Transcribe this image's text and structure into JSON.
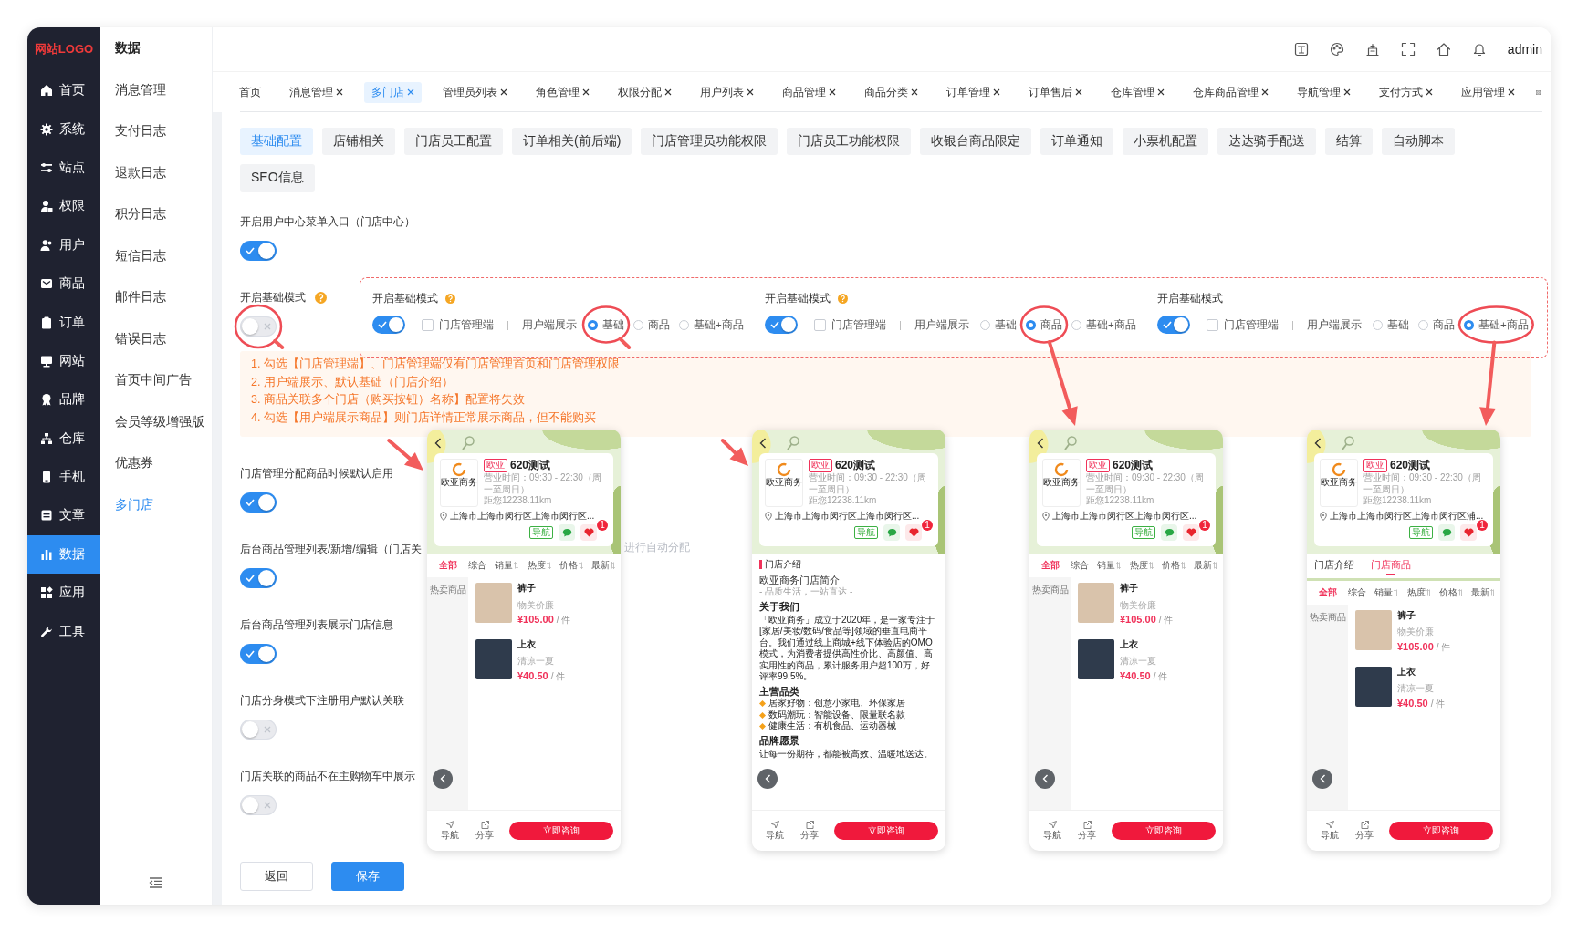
{
  "sidebar": {
    "logo": "网站LOGO",
    "items": [
      {
        "label": "首页",
        "selected": false
      },
      {
        "label": "系统",
        "selected": false
      },
      {
        "label": "站点",
        "selected": false
      },
      {
        "label": "权限",
        "selected": false
      },
      {
        "label": "用户",
        "selected": false
      },
      {
        "label": "商品",
        "selected": false
      },
      {
        "label": "订单",
        "selected": false
      },
      {
        "label": "网站",
        "selected": false
      },
      {
        "label": "品牌",
        "selected": false
      },
      {
        "label": "仓库",
        "selected": false
      },
      {
        "label": "手机",
        "selected": false
      },
      {
        "label": "文章",
        "selected": false
      },
      {
        "label": "数据",
        "selected": true
      },
      {
        "label": "应用",
        "selected": false
      },
      {
        "label": "工具",
        "selected": false
      }
    ]
  },
  "submenu": {
    "title": "数据",
    "items": [
      {
        "label": "消息管理",
        "selected": false
      },
      {
        "label": "支付日志",
        "selected": false
      },
      {
        "label": "退款日志",
        "selected": false
      },
      {
        "label": "积分日志",
        "selected": false
      },
      {
        "label": "短信日志",
        "selected": false
      },
      {
        "label": "邮件日志",
        "selected": false
      },
      {
        "label": "错误日志",
        "selected": false
      },
      {
        "label": "首页中间广告",
        "selected": false
      },
      {
        "label": "会员等级增强版",
        "selected": false
      },
      {
        "label": "优惠券",
        "selected": false
      },
      {
        "label": "多门店",
        "selected": true
      }
    ]
  },
  "header": {
    "user": "admin"
  },
  "tabs": [
    {
      "label": "首页",
      "selected": false,
      "closable": false
    },
    {
      "label": "消息管理",
      "selected": false,
      "closable": true
    },
    {
      "label": "多门店",
      "selected": true,
      "closable": true
    },
    {
      "label": "管理员列表",
      "selected": false,
      "closable": true
    },
    {
      "label": "角色管理",
      "selected": false,
      "closable": true
    },
    {
      "label": "权限分配",
      "selected": false,
      "closable": true
    },
    {
      "label": "用户列表",
      "selected": false,
      "closable": true
    },
    {
      "label": "商品管理",
      "selected": false,
      "closable": true
    },
    {
      "label": "商品分类",
      "selected": false,
      "closable": true
    },
    {
      "label": "订单管理",
      "selected": false,
      "closable": true
    },
    {
      "label": "订单售后",
      "selected": false,
      "closable": true
    },
    {
      "label": "仓库管理",
      "selected": false,
      "closable": true
    },
    {
      "label": "仓库商品管理",
      "selected": false,
      "closable": true
    },
    {
      "label": "导航管理",
      "selected": false,
      "closable": true
    },
    {
      "label": "支付方式",
      "selected": false,
      "closable": true
    },
    {
      "label": "应用管理",
      "selected": false,
      "closable": true
    }
  ],
  "config_tabs": [
    {
      "label": "基础配置",
      "selected": true
    },
    {
      "label": "店铺相关",
      "selected": false
    },
    {
      "label": "门店员工配置",
      "selected": false
    },
    {
      "label": "订单相关(前后端)",
      "selected": false
    },
    {
      "label": "门店管理员功能权限",
      "selected": false
    },
    {
      "label": "门店员工功能权限",
      "selected": false
    },
    {
      "label": "收银台商品限定",
      "selected": false
    },
    {
      "label": "订单通知",
      "selected": false
    },
    {
      "label": "小票机配置",
      "selected": false
    },
    {
      "label": "达达骑手配送",
      "selected": false
    },
    {
      "label": "结算",
      "selected": false
    },
    {
      "label": "自动脚本",
      "selected": false
    },
    {
      "label": "SEO信息",
      "selected": false
    }
  ],
  "settings": [
    {
      "label": "开启用户中心菜单入口（门店中心）",
      "help": false,
      "on": true
    },
    {
      "label": "开启基础模式",
      "help": true,
      "on": false,
      "notes": [
        "1. 勾选【门店管理端】、门店管理端仅有门店管理首页和门店管理权限",
        "2. 用户端展示、默认基础（门店介绍）",
        "3. 商品关联多个门店（购买按钮）名称】配置将失效",
        "4. 勾选【用户端展示商品】则门店详情正常展示商品，但不能购买"
      ]
    },
    {
      "label": "门店管理分配商品时候默认启用",
      "help": false,
      "on": true
    },
    {
      "label": "后台商品管理列表/新增/编辑（门店关",
      "label_tail": "进行自动分配",
      "help": false,
      "on": true
    },
    {
      "label": "后台商品管理列表展示门店信息",
      "help": false,
      "on": true
    },
    {
      "label": "门店分身模式下注册用户默认关联",
      "help": false,
      "on": false
    },
    {
      "label": "门店关联的商品不在主购物车中展示",
      "help": false,
      "on": false
    }
  ],
  "mode_examples": [
    {
      "title": "开启基础模式",
      "help": true,
      "on": true,
      "checkbox": {
        "label": "门店管理端",
        "checked": false
      },
      "separator": "|",
      "display_label": "用户端展示",
      "options": [
        {
          "label": "基础",
          "selected": true
        },
        {
          "label": "商品",
          "selected": false
        },
        {
          "label": "基础+商品",
          "selected": false
        }
      ]
    },
    {
      "title": "开启基础模式",
      "help": true,
      "on": true,
      "checkbox": {
        "label": "门店管理端",
        "checked": false
      },
      "separator": "|",
      "display_label": "用户端展示",
      "options": [
        {
          "label": "基础",
          "selected": false
        },
        {
          "label": "商品",
          "selected": true
        },
        {
          "label": "基础+商品",
          "selected": false
        }
      ]
    },
    {
      "title": "开启基础模式",
      "help": false,
      "on": true,
      "checkbox": {
        "label": "门店管理端",
        "checked": false
      },
      "separator": "|",
      "display_label": "用户端展示",
      "options": [
        {
          "label": "基础",
          "selected": false
        },
        {
          "label": "商品",
          "selected": false
        },
        {
          "label": "基础+商品",
          "selected": true
        }
      ]
    }
  ],
  "phone_previews": [
    {
      "kind": "products",
      "store": {
        "logo_text": "欧亚商务",
        "tag": "欧亚",
        "name": "620测试",
        "hours": "营业时间：09:30 - 22:30（周一至周日）",
        "distance": "距您12238.11km",
        "address": "上海市上海市闵行区上海市闵行区...",
        "nav": "导航",
        "badge": "1"
      },
      "sort_tabs": [
        {
          "label": "全部",
          "selected": true,
          "sortable": false
        },
        {
          "label": "综合",
          "selected": false,
          "sortable": false
        },
        {
          "label": "销量",
          "selected": false,
          "sortable": true
        },
        {
          "label": "热度",
          "selected": false,
          "sortable": true
        },
        {
          "label": "价格",
          "selected": false,
          "sortable": true
        },
        {
          "label": "最新",
          "selected": false,
          "sortable": true
        }
      ],
      "category": "热卖商品",
      "products": [
        {
          "name": "裤子",
          "desc": "物美价廉",
          "price": "¥105.00",
          "unit": "/ 件"
        },
        {
          "name": "上衣",
          "desc": "清凉一夏",
          "price": "¥40.50",
          "unit": "/ 件"
        }
      ],
      "footer": {
        "nav": "导航",
        "share": "分享",
        "cta": "立即咨询"
      }
    },
    {
      "kind": "intro",
      "store": {
        "logo_text": "欧亚商务",
        "tag": "欧亚",
        "name": "620测试",
        "hours": "营业时间：09:30 - 22:30（周一至周日）",
        "distance": "距您12238.11km",
        "address": "上海市上海市闵行区上海市闵行区...",
        "nav": "导航",
        "badge": "1"
      },
      "intro": {
        "title": "门店介绍",
        "heading": "欧亚商务门店简介",
        "subtitle": "- 品质生活，一站直达 -",
        "blocks": [
          {
            "kind": "heading",
            "text": "关于我们"
          },
          {
            "kind": "paragraph",
            "text": "「欧亚商务」成立于2020年，是一家专注于[家居/美妆/数码/食品等]领域的垂直电商平台。我们通过线上商城+线下体验店的OMO模式，为消费者提供高性价比、高颜值、高实用性的商品，累计服务用户超100万，好评率99.5%。"
          },
          {
            "kind": "heading",
            "text": "主营品类"
          },
          {
            "kind": "bullet",
            "text": "居家好物：创意小家电、环保家居"
          },
          {
            "kind": "bullet",
            "text": "数码潮玩：智能设备、限量联名款"
          },
          {
            "kind": "bullet",
            "text": "健康生活：有机食品、运动器械"
          },
          {
            "kind": "heading",
            "text": "品牌愿景"
          },
          {
            "kind": "paragraph",
            "text": "让每一份期待，都能被高效、温暖地送达。"
          }
        ]
      },
      "footer": {
        "nav": "导航",
        "share": "分享",
        "cta": "立即咨询"
      }
    },
    {
      "kind": "products",
      "store": {
        "logo_text": "欧亚商务",
        "tag": "欧亚",
        "name": "620测试",
        "hours": "营业时间：09:30 - 22:30（周一至周日）",
        "distance": "距您12238.11km",
        "address": "上海市上海市闵行区上海市闵行区...",
        "nav": "导航",
        "badge": "1"
      },
      "sort_tabs": [
        {
          "label": "全部",
          "selected": true,
          "sortable": false
        },
        {
          "label": "综合",
          "selected": false,
          "sortable": false
        },
        {
          "label": "销量",
          "selected": false,
          "sortable": true
        },
        {
          "label": "热度",
          "selected": false,
          "sortable": true
        },
        {
          "label": "价格",
          "selected": false,
          "sortable": true
        },
        {
          "label": "最新",
          "selected": false,
          "sortable": true
        }
      ],
      "category": "热卖商品",
      "products": [
        {
          "name": "裤子",
          "desc": "物美价廉",
          "price": "¥105.00",
          "unit": "/ 件"
        },
        {
          "name": "上衣",
          "desc": "清凉一夏",
          "price": "¥40.50",
          "unit": "/ 件"
        }
      ],
      "footer": {
        "nav": "导航",
        "share": "分享",
        "cta": "立即咨询"
      }
    },
    {
      "kind": "products",
      "store": {
        "logo_text": "欧亚商务",
        "tag": "欧亚",
        "name": "620测试",
        "hours": "营业时间：09:30 - 22:30（周一至周日）",
        "distance": "距您12238.11km",
        "address": "上海市上海市闵行区上海市闵行区浦...",
        "nav": "导航",
        "badge": "1"
      },
      "store_tabs": [
        {
          "label": "门店介绍",
          "selected": false
        },
        {
          "label": "门店商品",
          "selected": true
        }
      ],
      "sort_tabs": [
        {
          "label": "全部",
          "selected": true,
          "sortable": false
        },
        {
          "label": "综合",
          "selected": false,
          "sortable": false
        },
        {
          "label": "销量",
          "selected": false,
          "sortable": true
        },
        {
          "label": "热度",
          "selected": false,
          "sortable": true
        },
        {
          "label": "价格",
          "selected": false,
          "sortable": true
        },
        {
          "label": "最新",
          "selected": false,
          "sortable": true
        }
      ],
      "category": "热卖商品",
      "products": [
        {
          "name": "裤子",
          "desc": "物美价廉",
          "price": "¥105.00",
          "unit": "/ 件"
        },
        {
          "name": "上衣",
          "desc": "清凉一夏",
          "price": "¥40.50",
          "unit": "/ 件"
        }
      ],
      "footer": {
        "nav": "导航",
        "share": "分享",
        "cta": "立即咨询"
      }
    }
  ],
  "buttons": [
    {
      "label": "返回",
      "kind": "default"
    },
    {
      "label": "保存",
      "kind": "primary"
    }
  ]
}
